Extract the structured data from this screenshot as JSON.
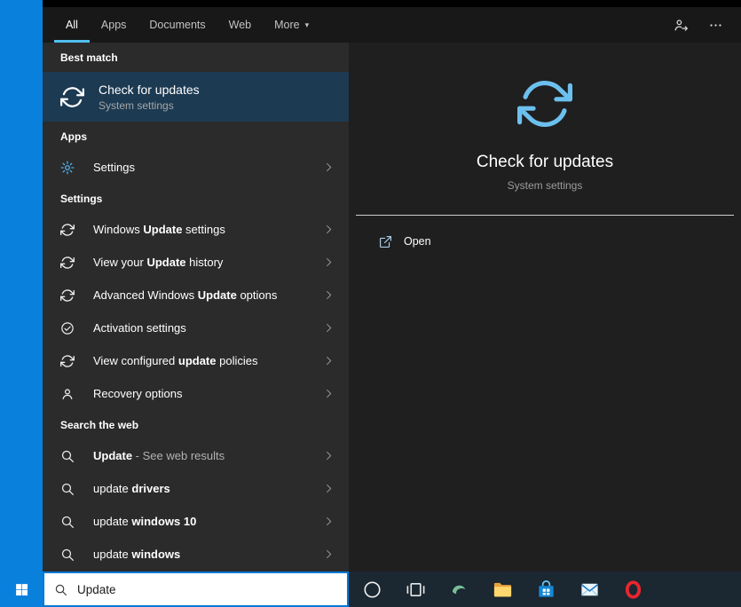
{
  "colors": {
    "accent": "#0078d7",
    "tab_underline": "#50c0f0",
    "selection_highlight": "#1c3a52",
    "desktop_blue": "#0a80dd",
    "taskbar_bg": "#1b2731",
    "list_bg": "#2b2b2b",
    "preview_bg": "#1f1f1f"
  },
  "tabs": {
    "items": [
      {
        "label": "All",
        "active": true
      },
      {
        "label": "Apps",
        "active": false
      },
      {
        "label": "Documents",
        "active": false
      },
      {
        "label": "Web",
        "active": false
      },
      {
        "label": "More",
        "active": false,
        "caret": true
      }
    ]
  },
  "results": {
    "rows": [
      {
        "kind": "header",
        "text": "Best match"
      },
      {
        "kind": "best",
        "name": "result-check-for-updates",
        "icon": "refresh",
        "selected": true,
        "title": "Check for updates",
        "subtitle": "System settings",
        "chevron": false
      },
      {
        "kind": "header",
        "text": "Apps"
      },
      {
        "kind": "item",
        "name": "result-settings-app",
        "icon": "gear",
        "chevron": true,
        "segments": [
          {
            "t": "Settings",
            "b": false
          }
        ]
      },
      {
        "kind": "header",
        "text": "Settings"
      },
      {
        "kind": "item",
        "name": "result-windows-update-settings",
        "icon": "refresh",
        "chevron": true,
        "segments": [
          {
            "t": "Windows ",
            "b": false
          },
          {
            "t": "Update",
            "b": true
          },
          {
            "t": " settings",
            "b": false
          }
        ]
      },
      {
        "kind": "item",
        "name": "result-view-your-update-history",
        "icon": "refresh",
        "chevron": true,
        "segments": [
          {
            "t": "View your ",
            "b": false
          },
          {
            "t": "Update",
            "b": true
          },
          {
            "t": " history",
            "b": false
          }
        ]
      },
      {
        "kind": "item",
        "name": "result-advanced-windows-update-options",
        "icon": "refresh",
        "chevron": true,
        "segments": [
          {
            "t": "Advanced Windows ",
            "b": false
          },
          {
            "t": "Update",
            "b": true
          },
          {
            "t": " options",
            "b": false
          }
        ]
      },
      {
        "kind": "item",
        "name": "result-activation-settings",
        "icon": "check-circle",
        "chevron": true,
        "segments": [
          {
            "t": "Activation settings",
            "b": false
          }
        ]
      },
      {
        "kind": "item",
        "name": "result-view-configured-update-policies",
        "icon": "refresh",
        "chevron": true,
        "segments": [
          {
            "t": "View configured ",
            "b": false
          },
          {
            "t": "update",
            "b": true
          },
          {
            "t": " policies",
            "b": false
          }
        ]
      },
      {
        "kind": "item",
        "name": "result-recovery-options",
        "icon": "person",
        "chevron": true,
        "segments": [
          {
            "t": "Recovery options",
            "b": false
          }
        ]
      },
      {
        "kind": "header",
        "text": "Search the web"
      },
      {
        "kind": "item",
        "name": "result-web-update",
        "icon": "search",
        "chevron": true,
        "segments": [
          {
            "t": "Update",
            "b": true
          },
          {
            "t": " - See web results",
            "b": false,
            "dim": true
          }
        ]
      },
      {
        "kind": "item",
        "name": "result-web-update-drivers",
        "icon": "search",
        "chevron": true,
        "segments": [
          {
            "t": "update ",
            "b": false
          },
          {
            "t": "drivers",
            "b": true
          }
        ]
      },
      {
        "kind": "item",
        "name": "result-web-update-windows-10",
        "icon": "search",
        "chevron": true,
        "segments": [
          {
            "t": "update ",
            "b": false
          },
          {
            "t": "windows 10",
            "b": true
          }
        ]
      },
      {
        "kind": "item",
        "name": "result-web-update-windows",
        "icon": "search",
        "chevron": true,
        "segments": [
          {
            "t": "update ",
            "b": false
          },
          {
            "t": "windows",
            "b": true
          }
        ]
      }
    ]
  },
  "preview": {
    "icon": "refresh",
    "title": "Check for updates",
    "subtitle": "System settings",
    "actions": [
      {
        "icon": "launch",
        "label": "Open"
      }
    ]
  },
  "taskbar": {
    "search_value": "Update",
    "icons": [
      "cortana",
      "task-view",
      "edge",
      "file-explorer",
      "store",
      "mail",
      "opera"
    ]
  }
}
